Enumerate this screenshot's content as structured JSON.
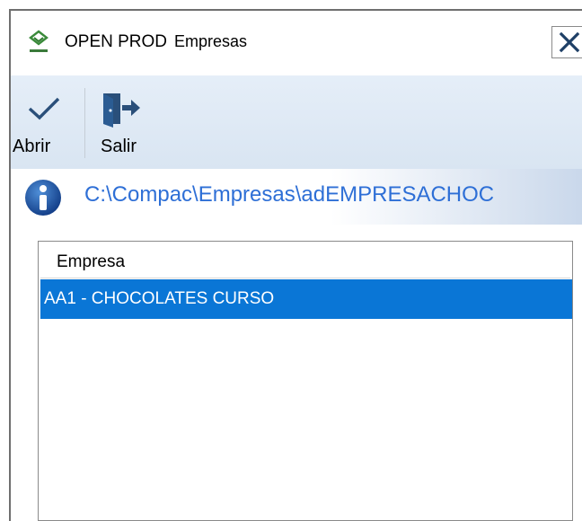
{
  "window": {
    "title_app": "OPEN PROD",
    "title_dialog": "Empresas"
  },
  "toolbar": {
    "open_label": "Abrir",
    "exit_label": "Salir"
  },
  "pathbar": {
    "path": "C:\\Compac\\Empresas\\adEMPRESACHOC"
  },
  "list": {
    "columns": [
      "Empresa"
    ],
    "rows": [
      {
        "empresa": "AA1 - CHOCOLATES CURSO",
        "selected": true
      }
    ]
  },
  "colors": {
    "accent": "#0a76d6",
    "path_text": "#2e6fd6",
    "toolbar_bg": "#dde8f4"
  },
  "icons": {
    "app": "app-logo-icon",
    "close": "close-icon",
    "open": "checkmark-icon",
    "exit": "exit-door-icon",
    "info": "info-icon"
  }
}
